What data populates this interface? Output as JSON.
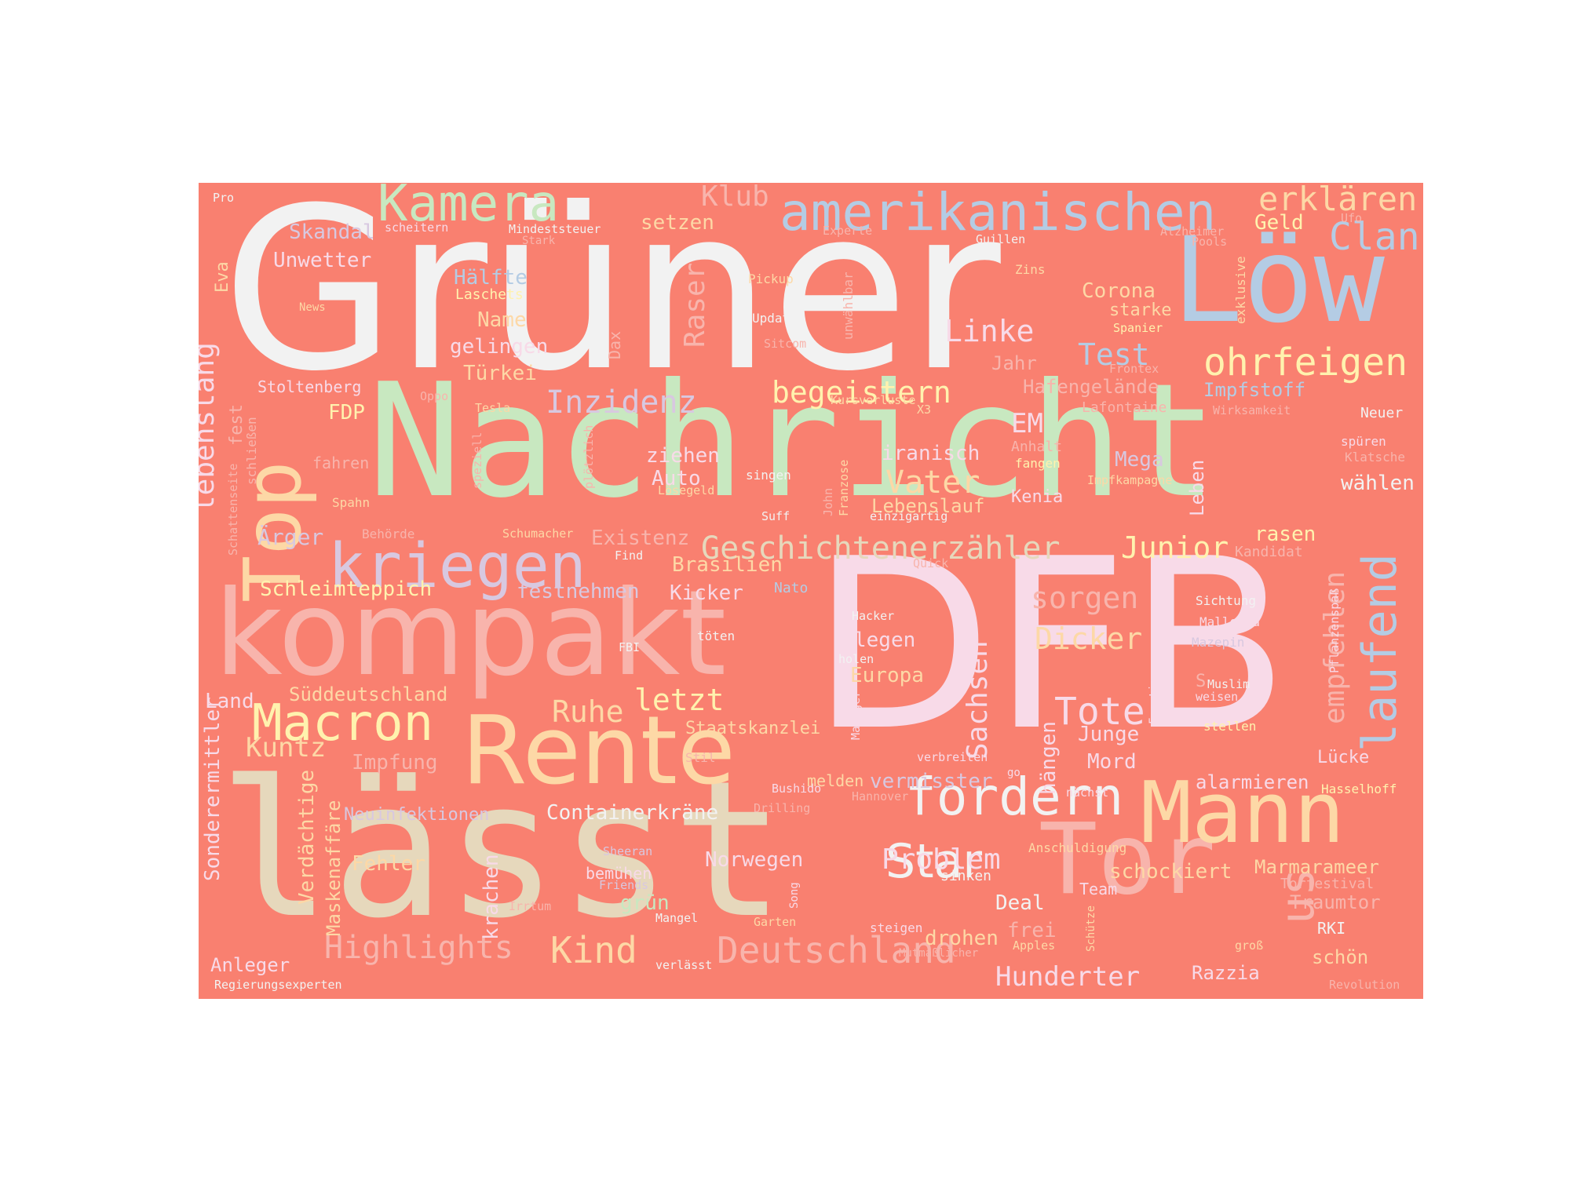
{
  "palette": {
    "background": "#f98070",
    "white": "#f2f2f2",
    "green": "#c8e8c0",
    "pink": "#f8dae8",
    "blue": "#b4cce4",
    "beige": "#e6d8bc",
    "salmon": "#f8b4ac",
    "yellow": "#fff2ae",
    "orange": "#fdd8a6",
    "lilac": "#d8c8e0",
    "peach": "#ffb09a"
  },
  "words": {
    "gruener": "Grüner",
    "nachricht": "Nachricht",
    "dfb": "DFB",
    "laesst": "lässt",
    "kompakt": "kompakt",
    "loew": "Löw",
    "tor": "Tor",
    "mann": "Mann",
    "rente": "Rente",
    "top": "Top",
    "kriegen": "kriegen",
    "amerikanischen": "amerikanischen",
    "kamera": "Kamera",
    "macron": "Macron",
    "fordern": "fordern",
    "star": "Star",
    "laufend": "laufend",
    "ohrfeigen": "ohrfeigen",
    "clan": "Clan",
    "erklaeren": "erklären",
    "us": "us",
    "deutschland": "Deutschland",
    "geschichtenerzaehler": "Geschichtenerzähler",
    "highlights": "Highlights",
    "tote": "Tote",
    "test": "Test",
    "inzidenz": "Inzidenz",
    "begeistern": "begeistern",
    "vater": "Vater",
    "linke": "Linke",
    "kind": "Kind",
    "hunderter": "Hunderter",
    "sorgen": "sorgen",
    "dicker": "Dicker",
    "problem": "Problem",
    "klub": "Klub",
    "raser": "Raser",
    "sachsen": "Sachsen",
    "junior": "Junior",
    "empfehlen": "empfehlen",
    "lebenslang": "lebenslang",
    "em": "EM",
    "letzt": "letzt",
    "ruhe": "Ruhe",
    "kuntz": "Kuntz",
    "unwetter": "Unwetter",
    "skandal": "Skandal",
    "corona": "Corona",
    "geld": "Geld",
    "haelfte": "Hälfte",
    "name": "Name",
    "gelingen": "gelingen",
    "tuerkei": "Türkei",
    "setzen": "setzen",
    "stoltenberg": "Stoltenberg",
    "fdp": "FDP",
    "hafengelaende": "Hafengelände",
    "impfstoff": "Impfstoff",
    "jahr": "Jahr",
    "starke": "starke",
    "ziehen": "ziehen",
    "auto": "Auto",
    "iranisch": "iranisch",
    "mega": "Mega",
    "lebenslauf": "Lebenslauf",
    "kenia": "Kenia",
    "leben": "Leben",
    "waehlen": "wählen",
    "aerger": "Ärger",
    "existenz": "Existenz",
    "brasilien": "Brasilien",
    "kicker": "Kicker",
    "festnehmen": "festnehmen",
    "schleimteppich": "Schleimteppich",
    "rasen": "rasen",
    "legen": "legen",
    "europa": "Europa",
    "land": "Land",
    "sueddeutschland": "Süddeutschland",
    "staatskanzlei": "Staatskanzlei",
    "junge": "Junge",
    "mord": "Mord",
    "haengen": "hängen",
    "impfung": "Impfung",
    "verdaechtige": "Verdächtige",
    "sonderermittler": "Sonderermittler",
    "maskenaffaere": "Maskenaffäre",
    "neuinfektionen": "Neuinfektionen",
    "containerkraene": "Containerkräne",
    "vermisster": "vermisster",
    "melden": "melden",
    "alarmieren": "alarmieren",
    "luecke": "Lücke",
    "fehler": "Fehler",
    "krachen": "krachen",
    "norwegen": "Norwegen",
    "bemuehen": "bemühen",
    "gruen": "grün",
    "schockiert": "schockiert",
    "marmarameer": "Marmarameer",
    "traumtor": "Traumtor",
    "deal": "Deal",
    "frei": "frei",
    "drohen": "drohen",
    "rki": "RKI",
    "schoen": "schön",
    "razzia": "Razzia",
    "anleger": "Anleger",
    "team": "Team",
    "eva": "Eva",
    "fest": "fest",
    "fahren": "fahren",
    "zins": "Zins",
    "laschets": "Laschets",
    "exklusive": "exklusive",
    "neuer": "Neuer",
    "dax": "Dax",
    "update": "Update",
    "pickup": "Pickup",
    "unwaehlbar": "unwählbar",
    "anhalt": "Anhalt",
    "fangen": "fangen",
    "impfkampagne": "Impfkampagne",
    "lafontaine": "Lafontaine",
    "spueren": "spüren",
    "klatsche": "Klatsche",
    "singen": "singen",
    "loesegeld": "Lösegeld",
    "schumacher": "Schumacher",
    "spahn": "Spahn",
    "behoerde": "Behörde",
    "schliessen": "schließen",
    "schattenseite": "Schattenseite",
    "oppo": "Oppo",
    "tesla": "Tesla",
    "speziell": "speziell",
    "ploetzlich": "plötzlich",
    "kursverluste": "Kursverluste",
    "x3": "X3",
    "suff": "Suff",
    "einzigartig": "einzigartig",
    "john": "John",
    "franzose": "Franzose",
    "find": "Find",
    "quick": "Quick",
    "kandidat": "Kandidat",
    "nato": "Nato",
    "hacker": "Hacker",
    "toeten": "töten",
    "holen": "holen",
    "fbi": "FBI",
    "manager": "Manager",
    "sichtung": "Sichtung",
    "mallorca": "Mallorca",
    "mazepin": "Mazepin",
    "pflanzenspass": "Pflanzenspaß",
    "muslim": "Muslim",
    "weisen": "weisen",
    "stellen": "stellen",
    "facetime": "Facetime",
    "s_letter": "S",
    "stil": "Stil",
    "verbreiten": "verbreiten",
    "go": "go",
    "bushido": "Bushido",
    "hannover": "Hannover",
    "drilling": "Drilling",
    "naechst": "nächst",
    "hasselhoff": "Hasselhoff",
    "sheeran": "Sheeran",
    "friends": "Friends",
    "song": "Song",
    "anschuldigung": "Anschuldigung",
    "sinken": "sinken",
    "torfestival": "Torfestival",
    "irrtum": "Irrtum",
    "mangel": "Mangel",
    "garten": "Garten",
    "steigen": "steigen",
    "schuetze": "Schütze",
    "apples": "Apples",
    "gross": "groß",
    "mutmasslicher": "Mutmaßlicher",
    "verlaesst": "verlässt",
    "revolution": "Revolution",
    "regierungsexperten": "Regierungsexperten",
    "pro": "Pro",
    "scheitern": "scheitern",
    "mindeststeuer": "Mindeststeuer",
    "stark": "Stark",
    "experte": "Experte",
    "alzheimer": "Alzheimer",
    "ufo": "Ufo",
    "guillen": "Guillen",
    "pools": "Pools",
    "spanier": "Spanier",
    "frontex": "Frontex",
    "wirksamkeit": "Wirksamkeit",
    "news": "News",
    "sitcom": "Sitcom"
  }
}
